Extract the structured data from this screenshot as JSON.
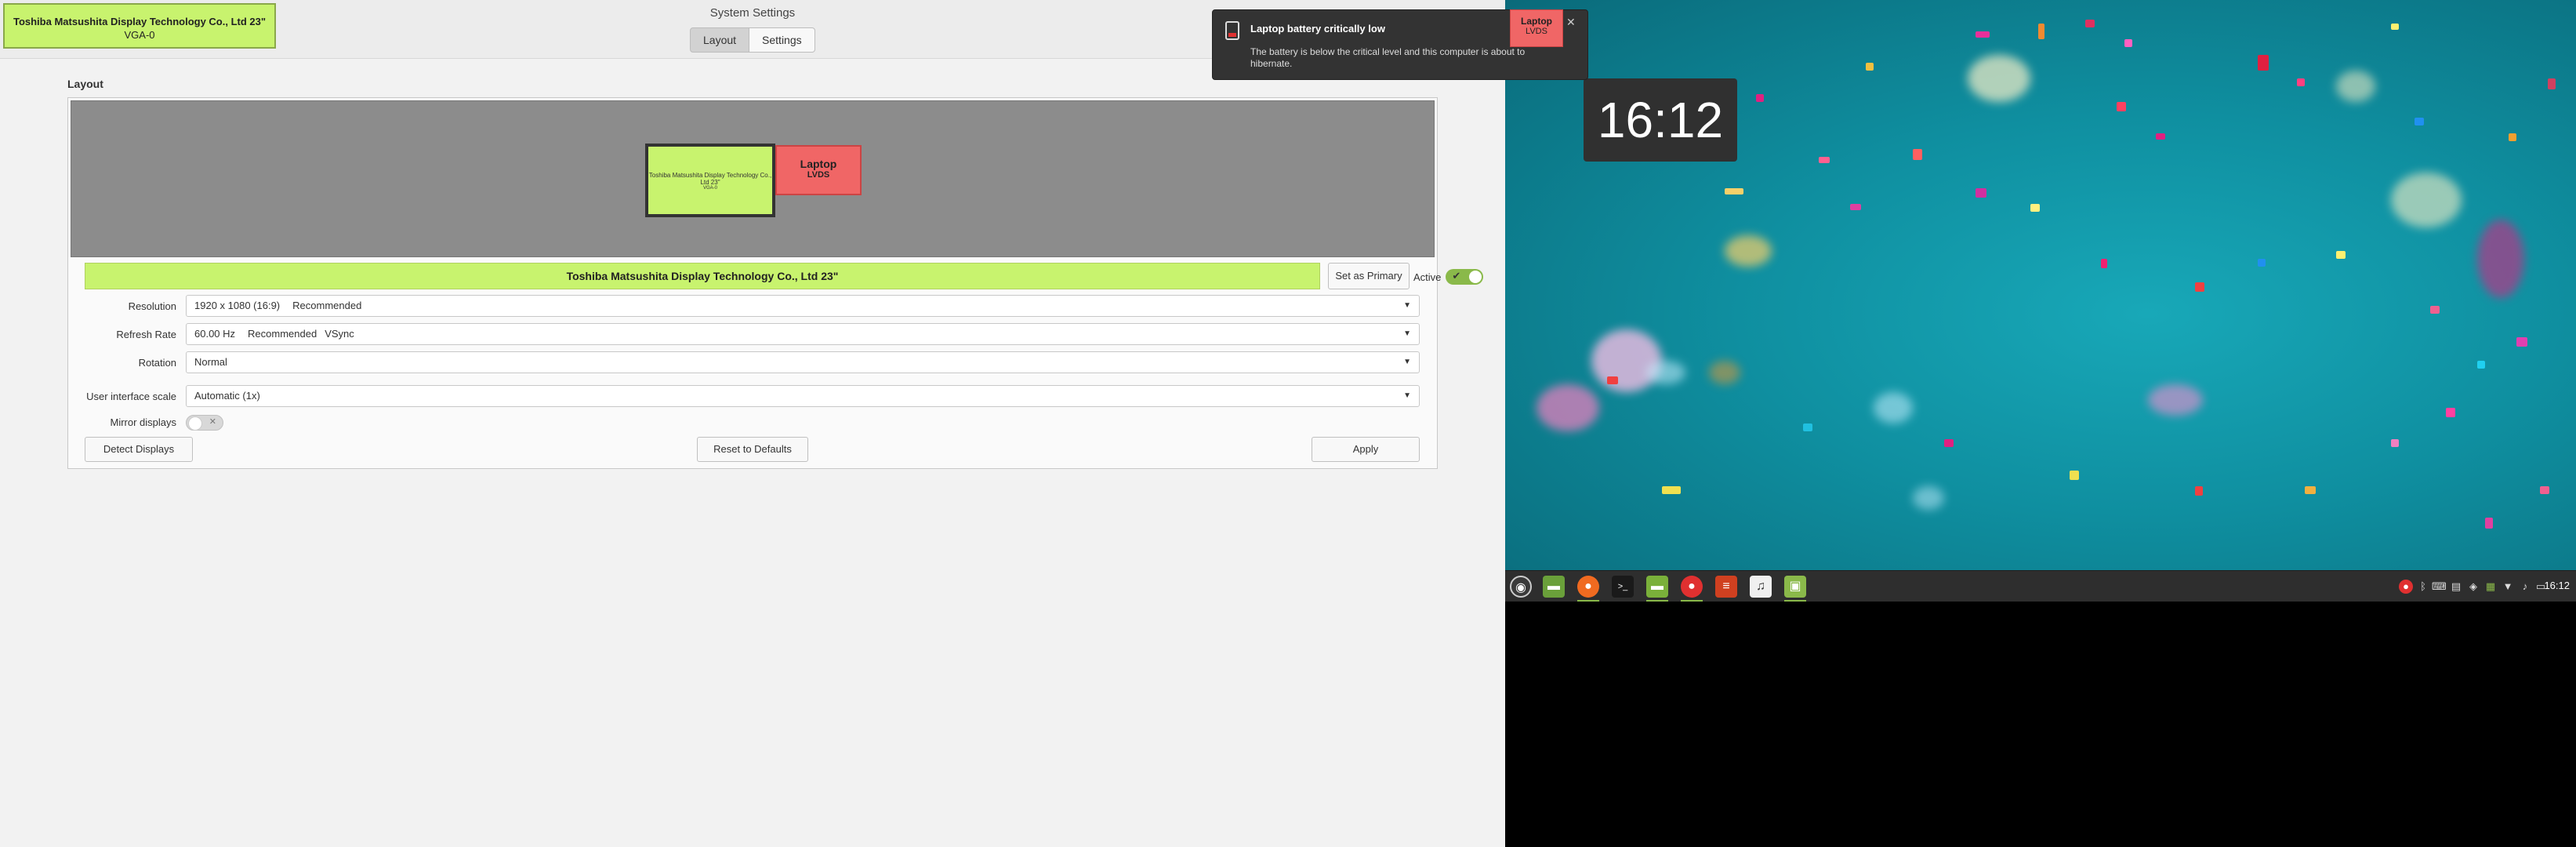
{
  "window": {
    "title": "System Settings",
    "tabs": [
      {
        "label": "Layout",
        "active": true
      },
      {
        "label": "Settings",
        "active": false
      }
    ]
  },
  "identify_overlay": {
    "name": "Toshiba Matsushita Display Technology Co., Ltd 23\"",
    "connector": "VGA-0",
    "color": "#c8f36e"
  },
  "layout": {
    "section_label": "Layout",
    "preview": {
      "primary": {
        "name": "Toshiba Matsushita Display Technology Co., Ltd 23\"",
        "connector": "VGA-0",
        "color": "#c8f36e"
      },
      "secondary": {
        "name": "Laptop",
        "connector": "LVDS",
        "color": "#f06666"
      }
    },
    "selected_monitor": "Toshiba Matsushita Display Technology Co., Ltd 23\"",
    "set_primary_label": "Set as Primary",
    "active_label": "Active",
    "active_checkmark": "✔",
    "settings": {
      "resolution_label": "Resolution",
      "resolution_value": "1920 x 1080 (16:9)",
      "resolution_note": "Recommended",
      "refresh_label": "Refresh Rate",
      "refresh_value": "60.00 Hz",
      "refresh_note": "Recommended",
      "refresh_vsync": "VSync",
      "rotation_label": "Rotation",
      "rotation_value": "Normal",
      "scale_label": "User interface scale",
      "scale_value": "Automatic (1x)",
      "mirror_label": "Mirror displays",
      "mirror_enabled": false,
      "mirror_toggle_glyph": "✕",
      "dropdown_arrow": "▼"
    },
    "buttons": {
      "detect": "Detect Displays",
      "reset": "Reset to Defaults",
      "apply": "Apply"
    }
  },
  "desktop": {
    "clock": "16:12"
  },
  "notification": {
    "title": "Laptop battery critically low",
    "body": "The battery is below the critical level and this computer is about to hibernate.",
    "close_glyph": "✕",
    "icon": "battery-low-icon"
  },
  "laptop_identify": {
    "name": "Laptop",
    "connector": "LVDS",
    "color": "#f06666"
  },
  "taskbar": {
    "clock": "16:12",
    "apps": [
      {
        "name": "menu-icon",
        "glyph": "◉"
      },
      {
        "name": "show-desktop-icon",
        "glyph": "▬"
      },
      {
        "name": "firefox-icon",
        "glyph": "●"
      },
      {
        "name": "terminal-icon",
        "glyph": ">_"
      },
      {
        "name": "files-icon",
        "glyph": "▬"
      },
      {
        "name": "app-red-icon",
        "glyph": "●"
      },
      {
        "name": "text-editor-icon",
        "glyph": "≡"
      },
      {
        "name": "music-icon",
        "glyph": "♫"
      },
      {
        "name": "display-settings-icon",
        "glyph": "▣"
      }
    ],
    "tray": [
      {
        "name": "update-icon",
        "glyph": "●"
      },
      {
        "name": "bluetooth-icon",
        "glyph": "ᛒ"
      },
      {
        "name": "keyboard-icon",
        "glyph": "⌨"
      },
      {
        "name": "clipboard-icon",
        "glyph": "▤"
      },
      {
        "name": "shield-icon",
        "glyph": "◈"
      },
      {
        "name": "notifications-icon",
        "glyph": "▦"
      },
      {
        "name": "network-icon",
        "glyph": "▼"
      },
      {
        "name": "volume-icon",
        "glyph": "♪"
      },
      {
        "name": "battery-icon",
        "glyph": "▭"
      }
    ]
  }
}
